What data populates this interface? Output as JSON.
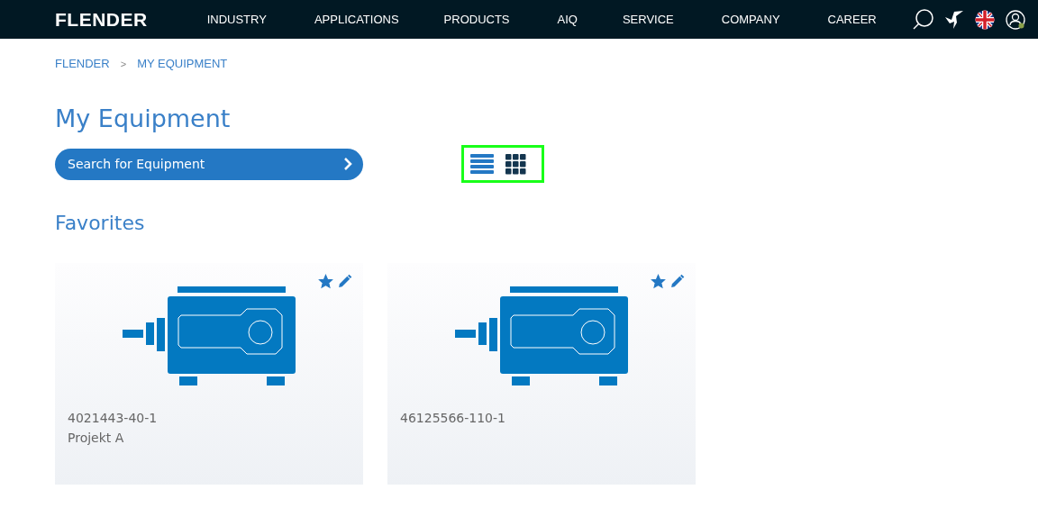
{
  "header": {
    "logo": "FLENDER",
    "nav": [
      "INDUSTRY",
      "APPLICATIONS",
      "PRODUCTS",
      "AIQ",
      "SERVICE",
      "COMPANY",
      "CAREER"
    ]
  },
  "breadcrumb": [
    "FLENDER",
    ">",
    "MY EQUIPMENT"
  ],
  "title": "My Equipment",
  "search": {
    "label": "Search for Equipment"
  },
  "view_toggle": [
    {
      "kind": "list",
      "selected": false
    },
    {
      "kind": "grid",
      "selected": true
    }
  ],
  "section_title": "Favorites",
  "cards": [
    {
      "serial": "4021443-40-1",
      "project": "Projekt A",
      "favorite": true
    },
    {
      "serial": "46125566-110-1",
      "favorite": true
    }
  ]
}
